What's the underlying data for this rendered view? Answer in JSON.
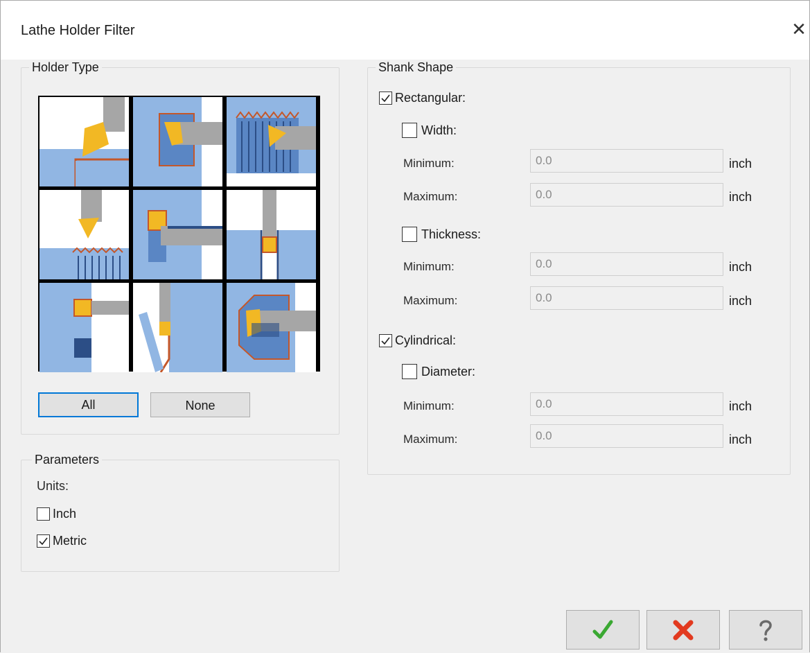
{
  "window": {
    "title": "Lathe Holder Filter",
    "close_glyph": "✕"
  },
  "holder_type": {
    "title": "Holder Type",
    "tiles": [
      {
        "name": "general-turning"
      },
      {
        "name": "face-grooving"
      },
      {
        "name": "od-threading"
      },
      {
        "name": "id-threading-insert"
      },
      {
        "name": "boring"
      },
      {
        "name": "grooving"
      },
      {
        "name": "face-parting"
      },
      {
        "name": "cut-off"
      },
      {
        "name": "id-boring-bar"
      }
    ],
    "all_label": "All",
    "none_label": "None"
  },
  "parameters": {
    "title": "Parameters",
    "units_label": "Units:",
    "inch": {
      "label": "Inch",
      "checked": false
    },
    "metric": {
      "label": "Metric",
      "checked": true
    }
  },
  "shank_shape": {
    "title": "Shank Shape",
    "rectangular": {
      "label": "Rectangular:",
      "checked": true
    },
    "width": {
      "label": "Width:",
      "checked": false
    },
    "thickness": {
      "label": "Thickness:",
      "checked": false
    },
    "cylindrical": {
      "label": "Cylindrical:",
      "checked": true
    },
    "diameter": {
      "label": "Diameter:",
      "checked": false
    },
    "min_label": "Minimum:",
    "max_label": "Maximum:",
    "unit": "inch",
    "width_min": "0.0",
    "width_max": "0.0",
    "thickness_min": "0.0",
    "thickness_max": "0.0",
    "diameter_min": "0.0",
    "diameter_max": "0.0"
  },
  "footer": {
    "ok_icon": "green-checkmark",
    "cancel_icon": "red-x",
    "help_icon": "question-mark"
  },
  "colors": {
    "accent": "#0078d7",
    "tile_blue": "#91b6e3",
    "insert_yellow": "#f2b824",
    "edge_red": "#c4572a",
    "holder_gray": "#a6a6a6"
  }
}
